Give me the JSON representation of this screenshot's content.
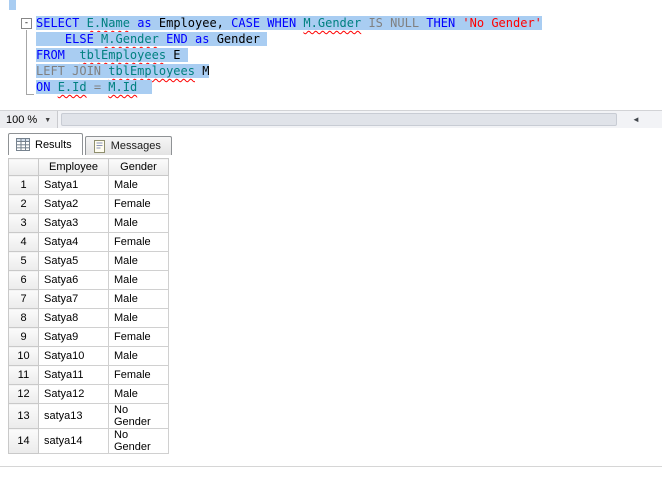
{
  "editor": {
    "selection_color": "#a9cdf2",
    "colors": {
      "kw": "#0000ff",
      "gray": "#808080",
      "id": "#008080",
      "str": "#ff0000",
      "pl": "#000000"
    },
    "lines": [
      {
        "segments": [
          {
            "t": "SELECT",
            "c": "kw"
          },
          {
            "t": " ",
            "c": "pl"
          },
          {
            "t": "E.Name",
            "c": "id",
            "sq": true
          },
          {
            "t": " ",
            "c": "pl"
          },
          {
            "t": "as",
            "c": "kw"
          },
          {
            "t": " ",
            "c": "pl"
          },
          {
            "t": "Employee,",
            "c": "pl"
          },
          {
            "t": " ",
            "c": "pl"
          },
          {
            "t": "CASE",
            "c": "kw"
          },
          {
            "t": " ",
            "c": "pl"
          },
          {
            "t": "WHEN",
            "c": "kw"
          },
          {
            "t": " ",
            "c": "pl"
          },
          {
            "t": "M.Gender",
            "c": "id",
            "sq": true
          },
          {
            "t": " ",
            "c": "pl"
          },
          {
            "t": "IS",
            "c": "gray"
          },
          {
            "t": " ",
            "c": "pl"
          },
          {
            "t": "NULL",
            "c": "gray"
          },
          {
            "t": " ",
            "c": "pl"
          },
          {
            "t": "THEN",
            "c": "kw"
          },
          {
            "t": " ",
            "c": "pl"
          },
          {
            "t": "'No Gender'",
            "c": "str"
          }
        ]
      },
      {
        "segments": [
          {
            "t": "    ",
            "c": "pl"
          },
          {
            "t": "ELSE",
            "c": "kw"
          },
          {
            "t": " ",
            "c": "pl"
          },
          {
            "t": "M.Gender",
            "c": "id",
            "sq": true
          },
          {
            "t": " ",
            "c": "pl"
          },
          {
            "t": "END",
            "c": "kw"
          },
          {
            "t": " ",
            "c": "pl"
          },
          {
            "t": "as",
            "c": "kw"
          },
          {
            "t": " ",
            "c": "pl"
          },
          {
            "t": "Gender",
            "c": "pl"
          },
          {
            "t": " ",
            "c": "pl"
          }
        ]
      },
      {
        "segments": [
          {
            "t": "FROM",
            "c": "kw"
          },
          {
            "t": "  ",
            "c": "pl"
          },
          {
            "t": "tblEmployees",
            "c": "id",
            "sq": true
          },
          {
            "t": " ",
            "c": "pl"
          },
          {
            "t": "E",
            "c": "pl"
          },
          {
            "t": " ",
            "c": "pl"
          }
        ]
      },
      {
        "segments": [
          {
            "t": "LEFT JOIN",
            "c": "gray"
          },
          {
            "t": " ",
            "c": "pl"
          },
          {
            "t": "tblEmployees",
            "c": "id",
            "sq": true
          },
          {
            "t": " ",
            "c": "pl"
          },
          {
            "t": "M",
            "c": "pl"
          }
        ]
      },
      {
        "segments": [
          {
            "t": "ON",
            "c": "kw"
          },
          {
            "t": " ",
            "c": "pl"
          },
          {
            "t": "E.Id",
            "c": "id",
            "sq": true
          },
          {
            "t": " ",
            "c": "pl"
          },
          {
            "t": "=",
            "c": "gray"
          },
          {
            "t": " ",
            "c": "pl"
          },
          {
            "t": "M.Id",
            "c": "id",
            "sq": true
          },
          {
            "t": "  ",
            "c": "pl"
          }
        ]
      }
    ]
  },
  "icons": {
    "chevron_down": "▼",
    "scroll_left": "◄",
    "collapse_minus": "-"
  },
  "zoom": {
    "value": "100 %"
  },
  "tabs": [
    {
      "label": "Results",
      "active": true
    },
    {
      "label": "Messages",
      "active": false
    }
  ],
  "grid": {
    "columns": [
      "Employee",
      "Gender"
    ],
    "rows": [
      {
        "n": "1",
        "cells": [
          "Satya1",
          "Male"
        ]
      },
      {
        "n": "2",
        "cells": [
          "Satya2",
          "Female"
        ]
      },
      {
        "n": "3",
        "cells": [
          "Satya3",
          "Male"
        ]
      },
      {
        "n": "4",
        "cells": [
          "Satya4",
          "Female"
        ]
      },
      {
        "n": "5",
        "cells": [
          "Satya5",
          "Male"
        ]
      },
      {
        "n": "6",
        "cells": [
          "Satya6",
          "Male"
        ]
      },
      {
        "n": "7",
        "cells": [
          "Satya7",
          "Male"
        ]
      },
      {
        "n": "8",
        "cells": [
          "Satya8",
          "Male"
        ]
      },
      {
        "n": "9",
        "cells": [
          "Satya9",
          "Female"
        ]
      },
      {
        "n": "10",
        "cells": [
          "Satya10",
          "Male"
        ]
      },
      {
        "n": "11",
        "cells": [
          "Satya11",
          "Female"
        ]
      },
      {
        "n": "12",
        "cells": [
          "Satya12",
          "Male"
        ]
      },
      {
        "n": "13",
        "cells": [
          "satya13",
          "No Gender"
        ]
      },
      {
        "n": "14",
        "cells": [
          "satya14",
          "No Gender"
        ]
      }
    ]
  }
}
